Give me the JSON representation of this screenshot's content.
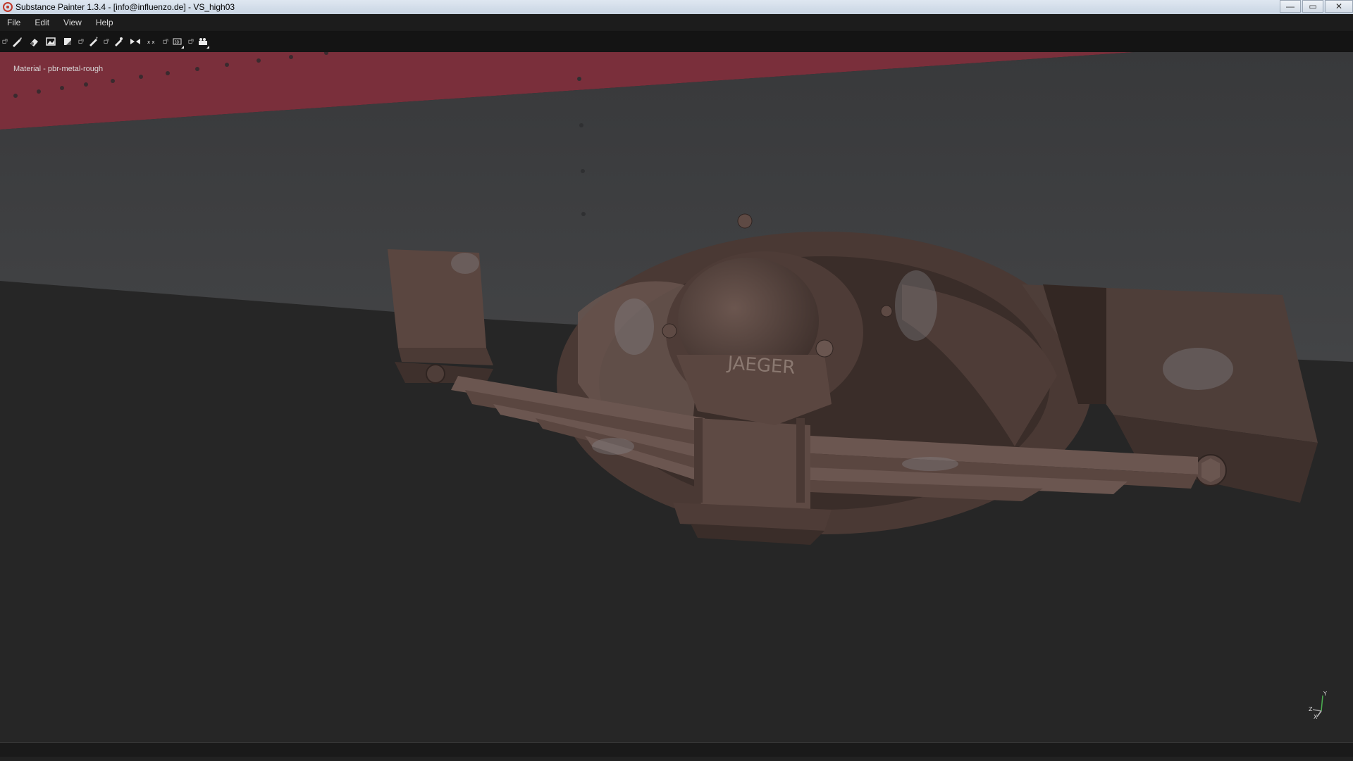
{
  "window": {
    "title": "Substance Painter 1.3.4 - [info@influenzo.de] - VS_high03",
    "controls": {
      "minimize": "—",
      "maximize": "▭",
      "close": "✕"
    },
    "icon": "substance-painter-logo"
  },
  "menu": {
    "items": [
      "File",
      "Edit",
      "View",
      "Help"
    ]
  },
  "toolbar": {
    "tools": [
      "paint-brush-icon",
      "eraser-icon",
      "projection-icon",
      "polygon-fill-icon",
      "smudge-icon",
      "clone-icon",
      "symmetry-icon",
      "2d-3d-view-icon",
      "camera-icon"
    ]
  },
  "viewport": {
    "material_label": "Material - pbr-metal-rough",
    "nameplate": "JAEGER",
    "axis_labels": {
      "y": "Y",
      "z": "Z",
      "x": "X"
    },
    "colors": {
      "background": "#262626",
      "panel": "#3e3f41",
      "red_stripe": "#7a2f3b",
      "rust_metal": "#5a4640"
    }
  }
}
